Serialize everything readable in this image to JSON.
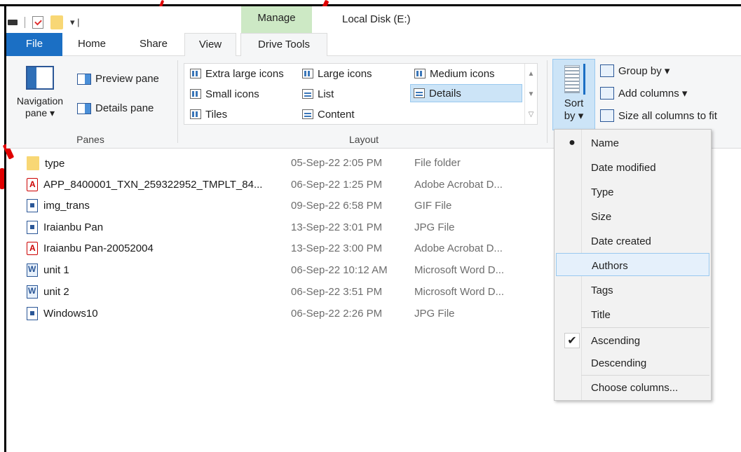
{
  "title_bar": {
    "manage_label": "Manage",
    "window_title": "Local Disk (E:)",
    "qat_dropdown": "▾ |"
  },
  "tabs": {
    "file": "File",
    "home": "Home",
    "share": "Share",
    "view": "View",
    "drive_tools": "Drive Tools"
  },
  "ribbon": {
    "panes": {
      "navigation_pane": "Navigation",
      "navigation_pane_2": "pane ▾",
      "preview_pane": "Preview pane",
      "details_pane": "Details pane",
      "group_label": "Panes"
    },
    "layout": {
      "extra_large_icons": "Extra large icons",
      "large_icons": "Large icons",
      "medium_icons": "Medium icons",
      "small_icons": "Small icons",
      "list": "List",
      "details": "Details",
      "tiles": "Tiles",
      "content": "Content",
      "group_label": "Layout",
      "selected": "Details"
    },
    "current_view": {
      "sort_by_1": "Sort",
      "sort_by_2": "by ▾",
      "group_by": "Group by ▾",
      "add_columns": "Add columns ▾",
      "size_all_columns": "Size all columns to fit"
    }
  },
  "files": [
    {
      "name": "type",
      "date": "05-Sep-22 2:05 PM",
      "type": "File folder",
      "icon": "folder-icon"
    },
    {
      "name": "APP_8400001_TXN_259322952_TMPLT_84...",
      "date": "06-Sep-22 1:25 PM",
      "type": "Adobe Acrobat D...",
      "icon": "pdf-icon"
    },
    {
      "name": "img_trans",
      "date": "09-Sep-22 6:58 PM",
      "type": "GIF File",
      "icon": "image-file-icon"
    },
    {
      "name": "Iraianbu Pan",
      "date": "13-Sep-22 3:01 PM",
      "type": "JPG File",
      "icon": "image-file-icon"
    },
    {
      "name": "Iraianbu Pan-20052004",
      "date": "13-Sep-22 3:00 PM",
      "type": "Adobe Acrobat D...",
      "icon": "pdf-icon"
    },
    {
      "name": "unit 1",
      "date": "06-Sep-22 10:12 AM",
      "type": "Microsoft Word D...",
      "icon": "word-doc-icon"
    },
    {
      "name": "unit 2",
      "date": "06-Sep-22 3:51 PM",
      "type": "Microsoft Word D...",
      "icon": "word-doc-icon"
    },
    {
      "name": "Windows10",
      "date": "06-Sep-22 2:26 PM",
      "type": "JPG File",
      "icon": "image-file-icon"
    }
  ],
  "sort_menu": {
    "items": [
      {
        "label": "Name",
        "mark": "●"
      },
      {
        "label": "Date modified",
        "mark": ""
      },
      {
        "label": "Type",
        "mark": ""
      },
      {
        "label": "Size",
        "mark": ""
      },
      {
        "label": "Date created",
        "mark": ""
      },
      {
        "label": "Authors",
        "mark": ""
      },
      {
        "label": "Tags",
        "mark": ""
      },
      {
        "label": "Title",
        "mark": ""
      }
    ],
    "order": [
      {
        "label": "Ascending",
        "mark": "✔"
      },
      {
        "label": "Descending",
        "mark": ""
      }
    ],
    "choose_columns": "Choose columns...",
    "highlighted": "Authors"
  },
  "colors": {
    "file_tab": "#1b6fc4",
    "manage_tab": "#cde9c5",
    "selection": "#cce4f7",
    "secondary_text": "#6d6d6d"
  }
}
